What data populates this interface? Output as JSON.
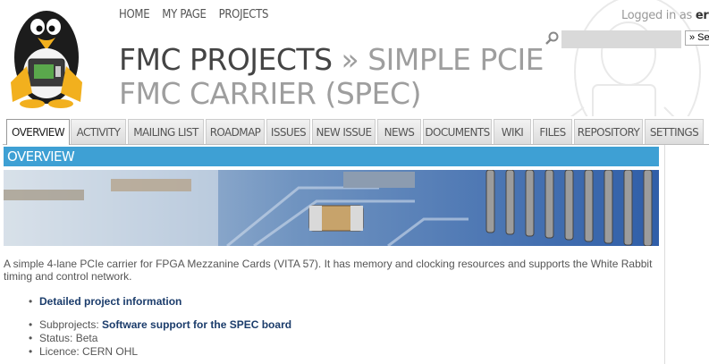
{
  "topnav": {
    "home": "HOME",
    "my_page": "MY PAGE",
    "projects": "PROJECTS"
  },
  "account": {
    "logged_in_as": "Logged in as",
    "username": "erikvar"
  },
  "search": {
    "placeholder": "",
    "jump_label": "» Sele"
  },
  "title": {
    "parent": "FMC PROJECTS",
    "separator": "»",
    "project": "SIMPLE PCIE FMC CARRIER (SPEC)"
  },
  "tabs": [
    "OVERVIEW",
    "ACTIVITY",
    "MAILING LIST",
    "ROADMAP",
    "ISSUES",
    "NEW ISSUE",
    "NEWS",
    "DOCUMENTS",
    "WIKI",
    "FILES",
    "REPOSITORY",
    "SETTINGS"
  ],
  "selected_tab": "OVERVIEW",
  "content": {
    "heading": "OVERVIEW",
    "description": "A simple 4-lane PCIe carrier for FPGA Mezzanine Cards (VITA 57). It has memory and clocking resources and supports the White Rabbit timing and control network.",
    "detailed_link": "Detailed project information",
    "subprojects_label": "Subprojects:",
    "subprojects_link": "Software support for the SPEC board",
    "status": "Status: Beta",
    "licence": "Licence: CERN OHL"
  },
  "colors": {
    "accent": "#3ea0d4",
    "link": "#1b3c6b"
  }
}
